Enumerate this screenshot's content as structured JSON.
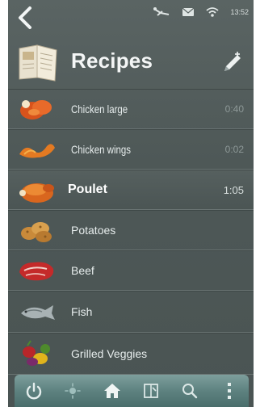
{
  "status": {
    "time": "13:52"
  },
  "header": {
    "title": "Recipes"
  },
  "recipes": [
    {
      "label": "Chicken large",
      "time": "0:40",
      "icon": "chicken-pieces-icon"
    },
    {
      "label": "Chicken wings",
      "time": "0:02",
      "icon": "chicken-wings-icon"
    },
    {
      "label": "Poulet",
      "time": "1:05",
      "icon": "roast-chicken-icon",
      "selected": true
    },
    {
      "label": "Potatoes",
      "time": "",
      "icon": "potatoes-icon"
    },
    {
      "label": "Beef",
      "time": "",
      "icon": "beef-icon"
    },
    {
      "label": "Fish",
      "time": "",
      "icon": "fish-icon"
    },
    {
      "label": "Grilled Veggies",
      "time": "",
      "icon": "veggies-icon"
    }
  ],
  "toolbar": {
    "buttons": [
      "power-icon",
      "light-icon",
      "home-icon",
      "book-icon",
      "search-icon",
      "more-icon"
    ]
  },
  "colors": {
    "background": "#4e5857",
    "toolbar": "#5e8280",
    "text": "#e6ecec",
    "time_dim": "#8d9897"
  }
}
